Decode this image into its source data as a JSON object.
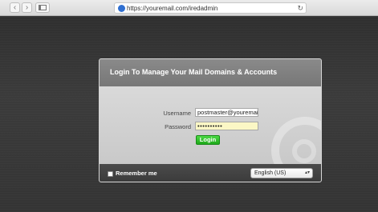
{
  "browser": {
    "back_glyph": "‹",
    "forward_glyph": "›",
    "url": "https://youremail.com/iredadmin",
    "reload_glyph": "↻"
  },
  "login": {
    "title": "Login To Manage Your Mail Domains & Accounts",
    "username_label": "Username",
    "username_value": "postmaster@youremai",
    "password_label": "Password",
    "password_value": "••••••••••",
    "login_button": "Login",
    "remember_label": "Remember me",
    "language_selected": "English (US)"
  },
  "colors": {
    "login_green": "#2fbf29",
    "password_bg": "#fbf7c5",
    "header_gray": "#808080"
  }
}
